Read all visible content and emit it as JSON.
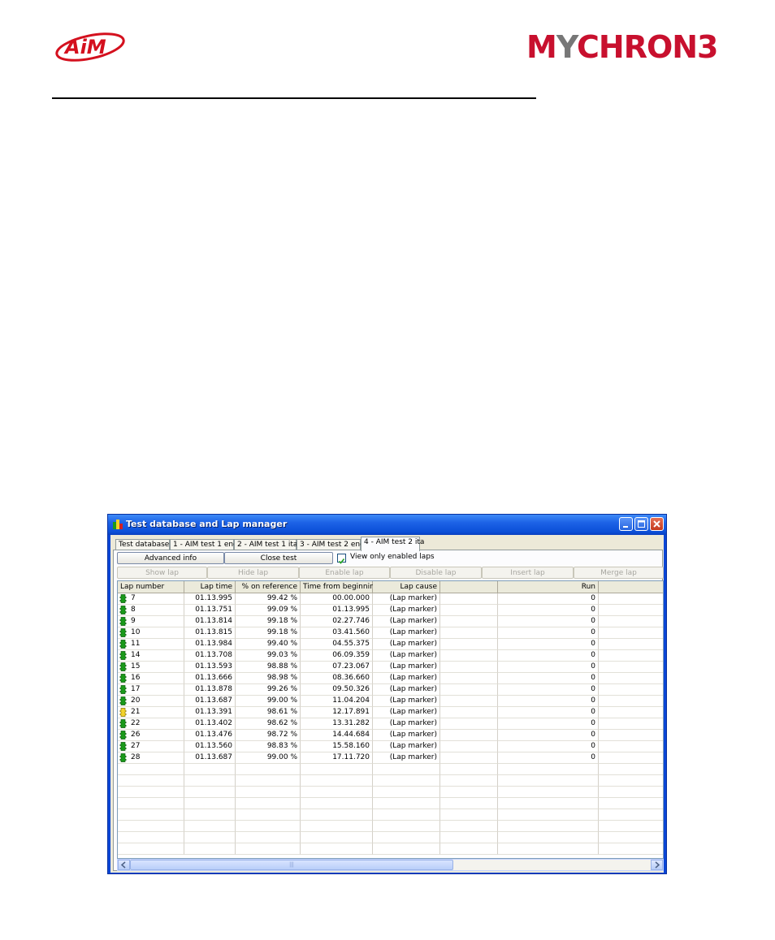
{
  "window": {
    "title": "Test database and Lap manager",
    "app_icon": "traffic-light-icon"
  },
  "tabs": [
    {
      "label": "Test database",
      "active": false
    },
    {
      "label": "1 - AIM test 1 eng",
      "active": false
    },
    {
      "label": "2 - AIM test 1 ita",
      "active": false
    },
    {
      "label": "3 - AIM test 2 eng",
      "active": false
    },
    {
      "label": "4 - AIM test 2 ita",
      "active": true
    }
  ],
  "toolbar": {
    "advanced_info": "Advanced info",
    "close_test": "Close test",
    "view_only_enabled": "View only enabled laps",
    "view_only_enabled_checked": true,
    "show_lap": "Show lap",
    "hide_lap": "Hide lap",
    "enable_lap": "Enable lap",
    "disable_lap": "Disable lap",
    "insert_lap": "Insert lap",
    "merge_lap": "Merge lap"
  },
  "table": {
    "columns": [
      "Lap number",
      "Lap time",
      "% on reference",
      "Time from beginning",
      "Lap cause",
      "",
      "Run"
    ],
    "rows": [
      {
        "flag": "green",
        "lap": "7",
        "time": "01.13.995",
        "pct": "99.42 %",
        "from_begin": "00.00.000",
        "cause": "(Lap marker)",
        "run": "0"
      },
      {
        "flag": "green",
        "lap": "8",
        "time": "01.13.751",
        "pct": "99.09 %",
        "from_begin": "01.13.995",
        "cause": "(Lap marker)",
        "run": "0"
      },
      {
        "flag": "green",
        "lap": "9",
        "time": "01.13.814",
        "pct": "99.18 %",
        "from_begin": "02.27.746",
        "cause": "(Lap marker)",
        "run": "0"
      },
      {
        "flag": "green",
        "lap": "10",
        "time": "01.13.815",
        "pct": "99.18 %",
        "from_begin": "03.41.560",
        "cause": "(Lap marker)",
        "run": "0"
      },
      {
        "flag": "green",
        "lap": "11",
        "time": "01.13.984",
        "pct": "99.40 %",
        "from_begin": "04.55.375",
        "cause": "(Lap marker)",
        "run": "0"
      },
      {
        "flag": "green",
        "lap": "14",
        "time": "01.13.708",
        "pct": "99.03 %",
        "from_begin": "06.09.359",
        "cause": "(Lap marker)",
        "run": "0"
      },
      {
        "flag": "green",
        "lap": "15",
        "time": "01.13.593",
        "pct": "98.88 %",
        "from_begin": "07.23.067",
        "cause": "(Lap marker)",
        "run": "0"
      },
      {
        "flag": "green",
        "lap": "16",
        "time": "01.13.666",
        "pct": "98.98 %",
        "from_begin": "08.36.660",
        "cause": "(Lap marker)",
        "run": "0"
      },
      {
        "flag": "green",
        "lap": "17",
        "time": "01.13.878",
        "pct": "99.26 %",
        "from_begin": "09.50.326",
        "cause": "(Lap marker)",
        "run": "0"
      },
      {
        "flag": "green",
        "lap": "20",
        "time": "01.13.687",
        "pct": "99.00 %",
        "from_begin": "11.04.204",
        "cause": "(Lap marker)",
        "run": "0"
      },
      {
        "flag": "yellow",
        "lap": "21",
        "time": "01.13.391",
        "pct": "98.61 %",
        "from_begin": "12.17.891",
        "cause": "(Lap marker)",
        "run": "0"
      },
      {
        "flag": "green",
        "lap": "22",
        "time": "01.13.402",
        "pct": "98.62 %",
        "from_begin": "13.31.282",
        "cause": "(Lap marker)",
        "run": "0"
      },
      {
        "flag": "green",
        "lap": "26",
        "time": "01.13.476",
        "pct": "98.72 %",
        "from_begin": "14.44.684",
        "cause": "(Lap marker)",
        "run": "0"
      },
      {
        "flag": "green",
        "lap": "27",
        "time": "01.13.560",
        "pct": "98.83 %",
        "from_begin": "15.58.160",
        "cause": "(Lap marker)",
        "run": "0"
      },
      {
        "flag": "green",
        "lap": "28",
        "time": "01.13.687",
        "pct": "99.00 %",
        "from_begin": "17.11.720",
        "cause": "(Lap marker)",
        "run": "0"
      }
    ]
  },
  "scroll": {
    "thumb_grip": "|||"
  },
  "colors": {
    "flag_green": "#1a9a1a",
    "flag_yellow": "#f2d22a",
    "logo_red": "#c8102e"
  }
}
